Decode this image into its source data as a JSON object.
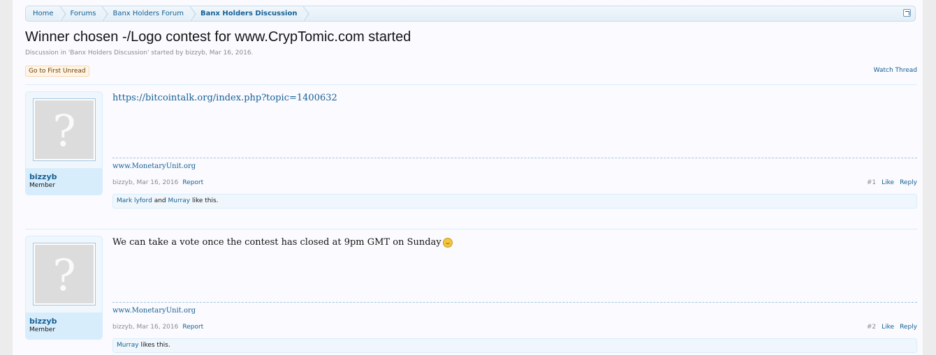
{
  "breadcrumb": [
    "Home",
    "Forums",
    "Banx Holders Forum",
    "Banx Holders Discussion"
  ],
  "thread": {
    "title": "Winner chosen -/Logo contest for www.CrypTomic.com started",
    "description_prefix": "Discussion in '",
    "forum": "Banx Holders Discussion",
    "description_mid": "' started by ",
    "author": "bizzyb",
    "description_suffix": ", Mar 16, 2016.",
    "go_first_unread": "Go to First Unread",
    "watch": "Watch Thread"
  },
  "posts": [
    {
      "username": "bizzyb",
      "user_title": "Member",
      "body_link": "https://bitcointalk.org/index.php?topic=1400632",
      "body_text": "",
      "signature": "www.MonetaryUnit.org",
      "meta_author": "bizzyb",
      "meta_date": "Mar 16, 2016",
      "report": "Report",
      "number": "#1",
      "like": "Like",
      "reply": "Reply",
      "likers": [
        "Mark lyford",
        "Murray"
      ],
      "likes_joiner": "and",
      "likes_suffix": "like this."
    },
    {
      "username": "bizzyb",
      "user_title": "Member",
      "body_link": "",
      "body_text": "We can take a vote once the contest has closed at 9pm GMT on Sunday",
      "signature": "www.MonetaryUnit.org",
      "meta_author": "bizzyb",
      "meta_date": "Mar 16, 2016",
      "report": "Report",
      "number": "#2",
      "like": "Like",
      "reply": "Reply",
      "likers": [
        "Murray"
      ],
      "likes_suffix": "likes this."
    }
  ],
  "icons": {
    "jump": "jump-to-icon",
    "avatar": "default-avatar-question-mark",
    "smilie": "smile-icon"
  },
  "colors": {
    "link": "#176093",
    "muted": "#8c8c8c",
    "panel": "#d7edfc"
  }
}
